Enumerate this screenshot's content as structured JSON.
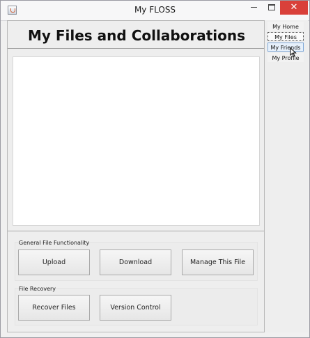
{
  "window": {
    "title": "My FLOSS"
  },
  "window_controls": {
    "close_glyph": "✕"
  },
  "page": {
    "heading": "My Files and Collaborations"
  },
  "sidebar": {
    "items": [
      {
        "label": "My Home"
      },
      {
        "label": "My Files",
        "state": "focused"
      },
      {
        "label": "My Friends",
        "state": "hover"
      },
      {
        "label": "My Profile"
      }
    ]
  },
  "general_group": {
    "label": "General File Functionality",
    "buttons": {
      "upload": "Upload",
      "download": "Download",
      "manage": "Manage This File"
    }
  },
  "recovery_group": {
    "label": "File Recovery",
    "buttons": {
      "recover": "Recover Files",
      "version": "Version Control"
    }
  },
  "colors": {
    "close_button": "#d9403a",
    "hover_border": "#7fa8d8"
  }
}
